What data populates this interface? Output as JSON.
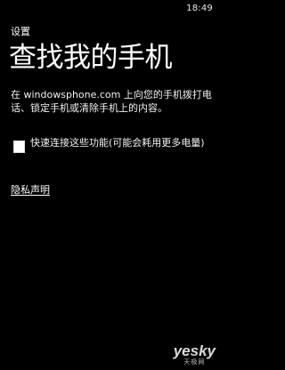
{
  "status_bar": {
    "time": "18:49"
  },
  "header": {
    "breadcrumb": "设置",
    "title": "查找我的手机"
  },
  "content": {
    "description": "在 windowsphone.com 上向您的手机拨打电话、锁定手机或清除手机上的内容。",
    "fast_connect": {
      "label": "快速连接这些功能(可能会耗用更多电量)",
      "checked": false
    },
    "privacy_link": "隐私声明"
  },
  "watermark": {
    "logo": "yesky",
    "sub": "天极网"
  }
}
